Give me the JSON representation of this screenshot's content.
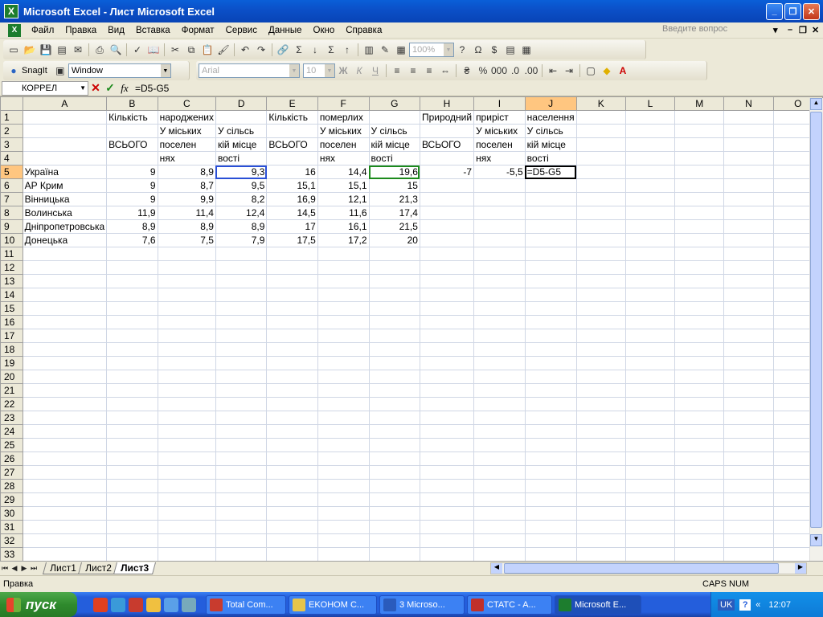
{
  "window": {
    "title": "Microsoft Excel - Лист Microsoft Excel",
    "app_icon": "excel-icon"
  },
  "menu": {
    "items": [
      "Файл",
      "Правка",
      "Вид",
      "Вставка",
      "Формат",
      "Сервис",
      "Данные",
      "Окно",
      "Справка"
    ],
    "help_placeholder": "Введите вопрос"
  },
  "toolbar": {
    "zoom": "100%"
  },
  "toolbar2": {
    "snagit_label": "SnagIt",
    "snagit_mode": "Window",
    "font_name": "Arial",
    "font_size": "10"
  },
  "formula_bar": {
    "name_box": "КОРРЕЛ",
    "formula": "=D5-G5"
  },
  "grid": {
    "columns": [
      "A",
      "B",
      "C",
      "D",
      "E",
      "F",
      "G",
      "H",
      "I",
      "J",
      "K",
      "L",
      "M",
      "N",
      "O"
    ],
    "selected_column": "J",
    "selected_row": 5,
    "row_count": 33,
    "rows": [
      [
        "",
        "Кількість",
        "народжених",
        "",
        "Кількість",
        "померлих",
        "",
        "Природний",
        "приріст",
        "населення",
        "",
        "",
        "",
        "",
        ""
      ],
      [
        "",
        "",
        "У міських",
        "У сільсь",
        "",
        "У міських",
        "У сільсь",
        "",
        "У міських",
        "У сільсь",
        "",
        "",
        "",
        "",
        ""
      ],
      [
        "",
        "ВСЬОГО",
        "поселен",
        "кій місце",
        "ВСЬОГО",
        "поселен",
        "кій місце",
        "ВСЬОГО",
        "поселен",
        "кій місце",
        "",
        "",
        "",
        "",
        ""
      ],
      [
        "",
        "",
        "нях",
        "вості",
        "",
        "нях",
        "вості",
        "",
        "нях",
        "вості",
        "",
        "",
        "",
        "",
        ""
      ],
      [
        "Україна",
        "9",
        "8,9",
        "9,3",
        "16",
        "14,4",
        "19,6",
        "-7",
        "-5,5",
        "=D5-G5",
        "",
        "",
        "",
        "",
        ""
      ],
      [
        "АР Крим",
        "9",
        "8,7",
        "9,5",
        "15,1",
        "15,1",
        "15",
        "",
        "",
        "",
        "",
        "",
        "",
        "",
        ""
      ],
      [
        "Вінницька",
        "9",
        "9,9",
        "8,2",
        "16,9",
        "12,1",
        "21,3",
        "",
        "",
        "",
        "",
        "",
        "",
        "",
        ""
      ],
      [
        "Волинська",
        "11,9",
        "11,4",
        "12,4",
        "14,5",
        "11,6",
        "17,4",
        "",
        "",
        "",
        "",
        "",
        "",
        "",
        ""
      ],
      [
        "Дніпропетровська",
        "8,9",
        "8,9",
        "8,9",
        "17",
        "16,1",
        "21,5",
        "",
        "",
        "",
        "",
        "",
        "",
        "",
        ""
      ],
      [
        "Донецька",
        "7,6",
        "7,5",
        "7,9",
        "17,5",
        "17,2",
        "20",
        "",
        "",
        "",
        "",
        "",
        "",
        "",
        ""
      ]
    ]
  },
  "sheets": [
    "Лист1",
    "Лист2",
    "Лист3"
  ],
  "active_sheet": "Лист3",
  "status": {
    "left": "Правка",
    "indicators": "CAPS NUM"
  },
  "taskbar": {
    "start_label": "пуск",
    "tasks": [
      {
        "label": "Total Com...",
        "icon_color": "#c83b2e"
      },
      {
        "label": "EKOHOM C...",
        "icon_color": "#e6c44a"
      },
      {
        "label": "3 Microso...",
        "icon_color": "#2a5bbd"
      },
      {
        "label": "CTATC - A...",
        "icon_color": "#c0302a"
      },
      {
        "label": "Microsoft E...",
        "icon_color": "#1d7d2e"
      }
    ],
    "lang": "UK",
    "clock": "12:07"
  }
}
